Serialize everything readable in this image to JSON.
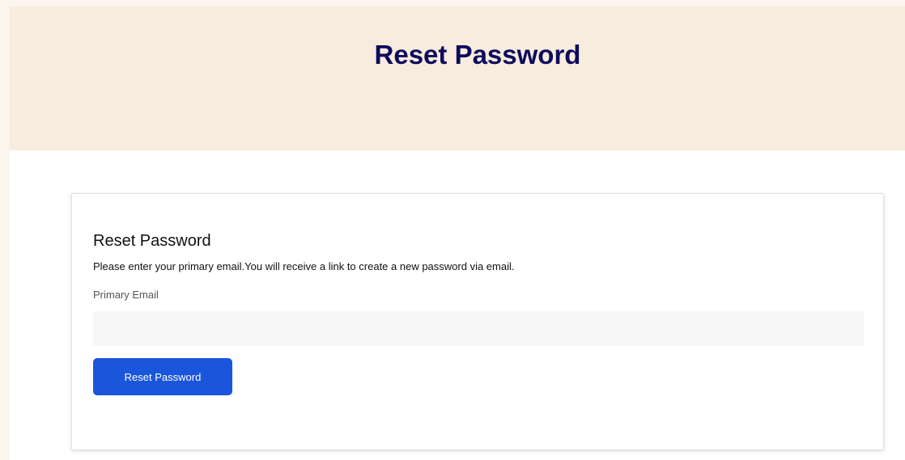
{
  "header": {
    "title": "Reset Password"
  },
  "form": {
    "title": "Reset Password",
    "description": "Please enter your primary email.You will receive a link to create a new password via email.",
    "email_label": "Primary Email",
    "email_value": "",
    "email_placeholder": "",
    "submit_label": "Reset Password"
  },
  "colors": {
    "header_background": "#f8ecdf",
    "header_title": "#0e0b5c",
    "button_background": "#1a56db",
    "input_background": "#f7f7f7"
  }
}
